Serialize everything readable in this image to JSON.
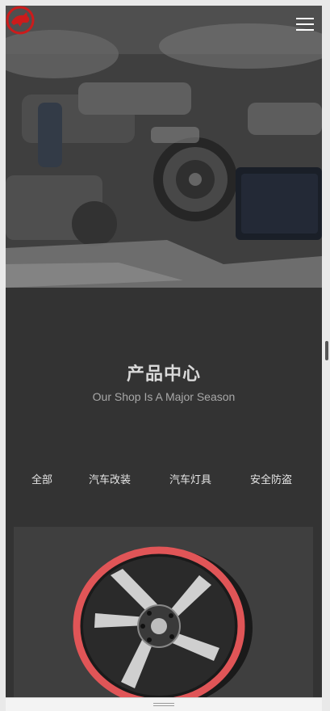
{
  "header": {
    "logo_icon": "horse-logo-icon",
    "menu_icon": "hamburger-menu-icon",
    "brand_color": "#cc1b1b"
  },
  "hero": {
    "image": "car-engine-photo"
  },
  "products": {
    "title": "产品中心",
    "subtitle": "Our Shop Is A Major Season",
    "categories": [
      "全部",
      "汽车改装",
      "汽车灯具",
      "安全防盗"
    ]
  },
  "product_card": {
    "image": "red-rim-alloy-wheel-photo"
  }
}
